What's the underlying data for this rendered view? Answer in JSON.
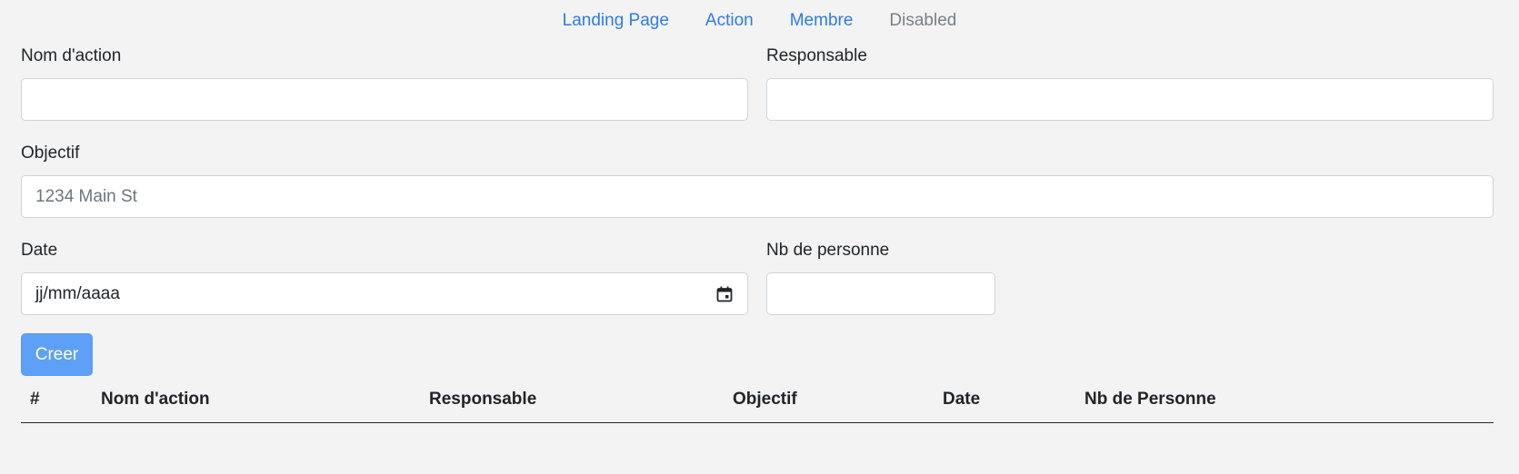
{
  "nav": {
    "items": [
      {
        "label": "Landing Page",
        "disabled": false
      },
      {
        "label": "Action",
        "disabled": false
      },
      {
        "label": "Membre",
        "disabled": false
      },
      {
        "label": "Disabled",
        "disabled": true
      }
    ]
  },
  "form": {
    "nom_action": {
      "label": "Nom d'action",
      "value": "",
      "placeholder": ""
    },
    "responsable": {
      "label": "Responsable",
      "value": "",
      "placeholder": ""
    },
    "objectif": {
      "label": "Objectif",
      "value": "",
      "placeholder": "1234 Main St"
    },
    "date": {
      "label": "Date",
      "value": "jj/mm/aaaa"
    },
    "nb_personne": {
      "label": "Nb de personne",
      "value": "",
      "placeholder": ""
    },
    "submit_label": "Creer"
  },
  "table": {
    "columns": [
      "#",
      "Nom d'action",
      "Responsable",
      "Objectif",
      "Date",
      "Nb de Personne"
    ],
    "rows": []
  },
  "colors": {
    "background": "#f3f3f3",
    "link": "#2f7bea",
    "disabled_link": "#7a7f85",
    "button": "#5fa0f7"
  },
  "icons": {
    "calendar": "calendar-icon"
  }
}
